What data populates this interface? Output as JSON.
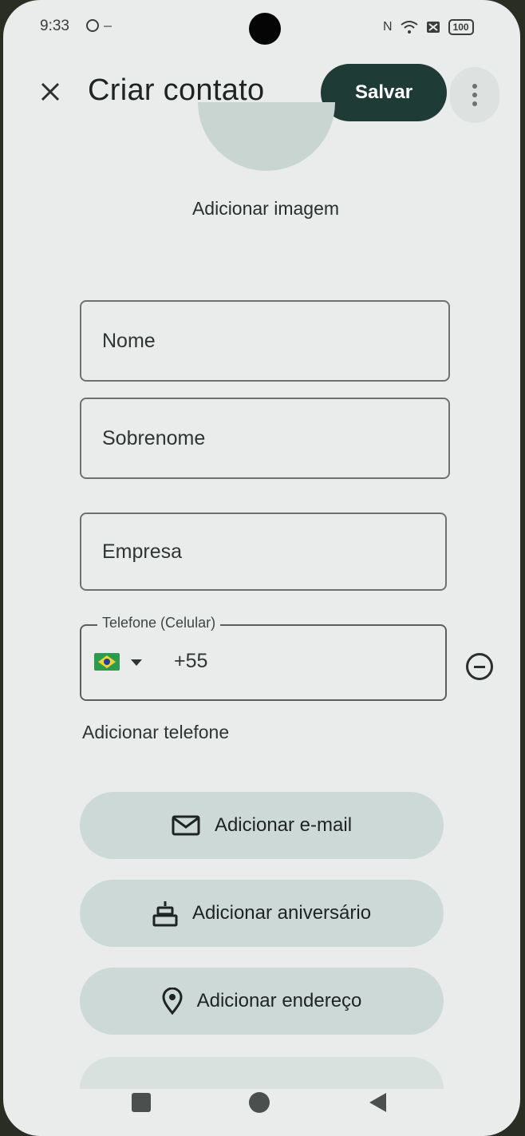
{
  "status_bar": {
    "time": "9:33",
    "nfc": "N",
    "wifi": "wifi-icon",
    "battery": "100"
  },
  "header": {
    "title": "Criar contato",
    "save_label": "Salvar",
    "close_icon": "close-icon",
    "more_icon": "more-vert-icon"
  },
  "photo": {
    "add_image_label": "Adicionar imagem"
  },
  "fields": {
    "first_name_placeholder": "Nome",
    "last_name_placeholder": "Sobrenome",
    "company_placeholder": "Empresa",
    "phone_label": "Telefone (Celular)",
    "phone_code": "+55"
  },
  "add_phone_label": "Adicionar telefone",
  "actions": {
    "email_label": "Adicionar e-mail",
    "birthday_label": "Adicionar aniversário",
    "address_label": "Adicionar endereço"
  },
  "colors": {
    "save_button": "#1f3b36",
    "pill_background": "#cdd9d6",
    "screen_background": "#e9ecea"
  }
}
